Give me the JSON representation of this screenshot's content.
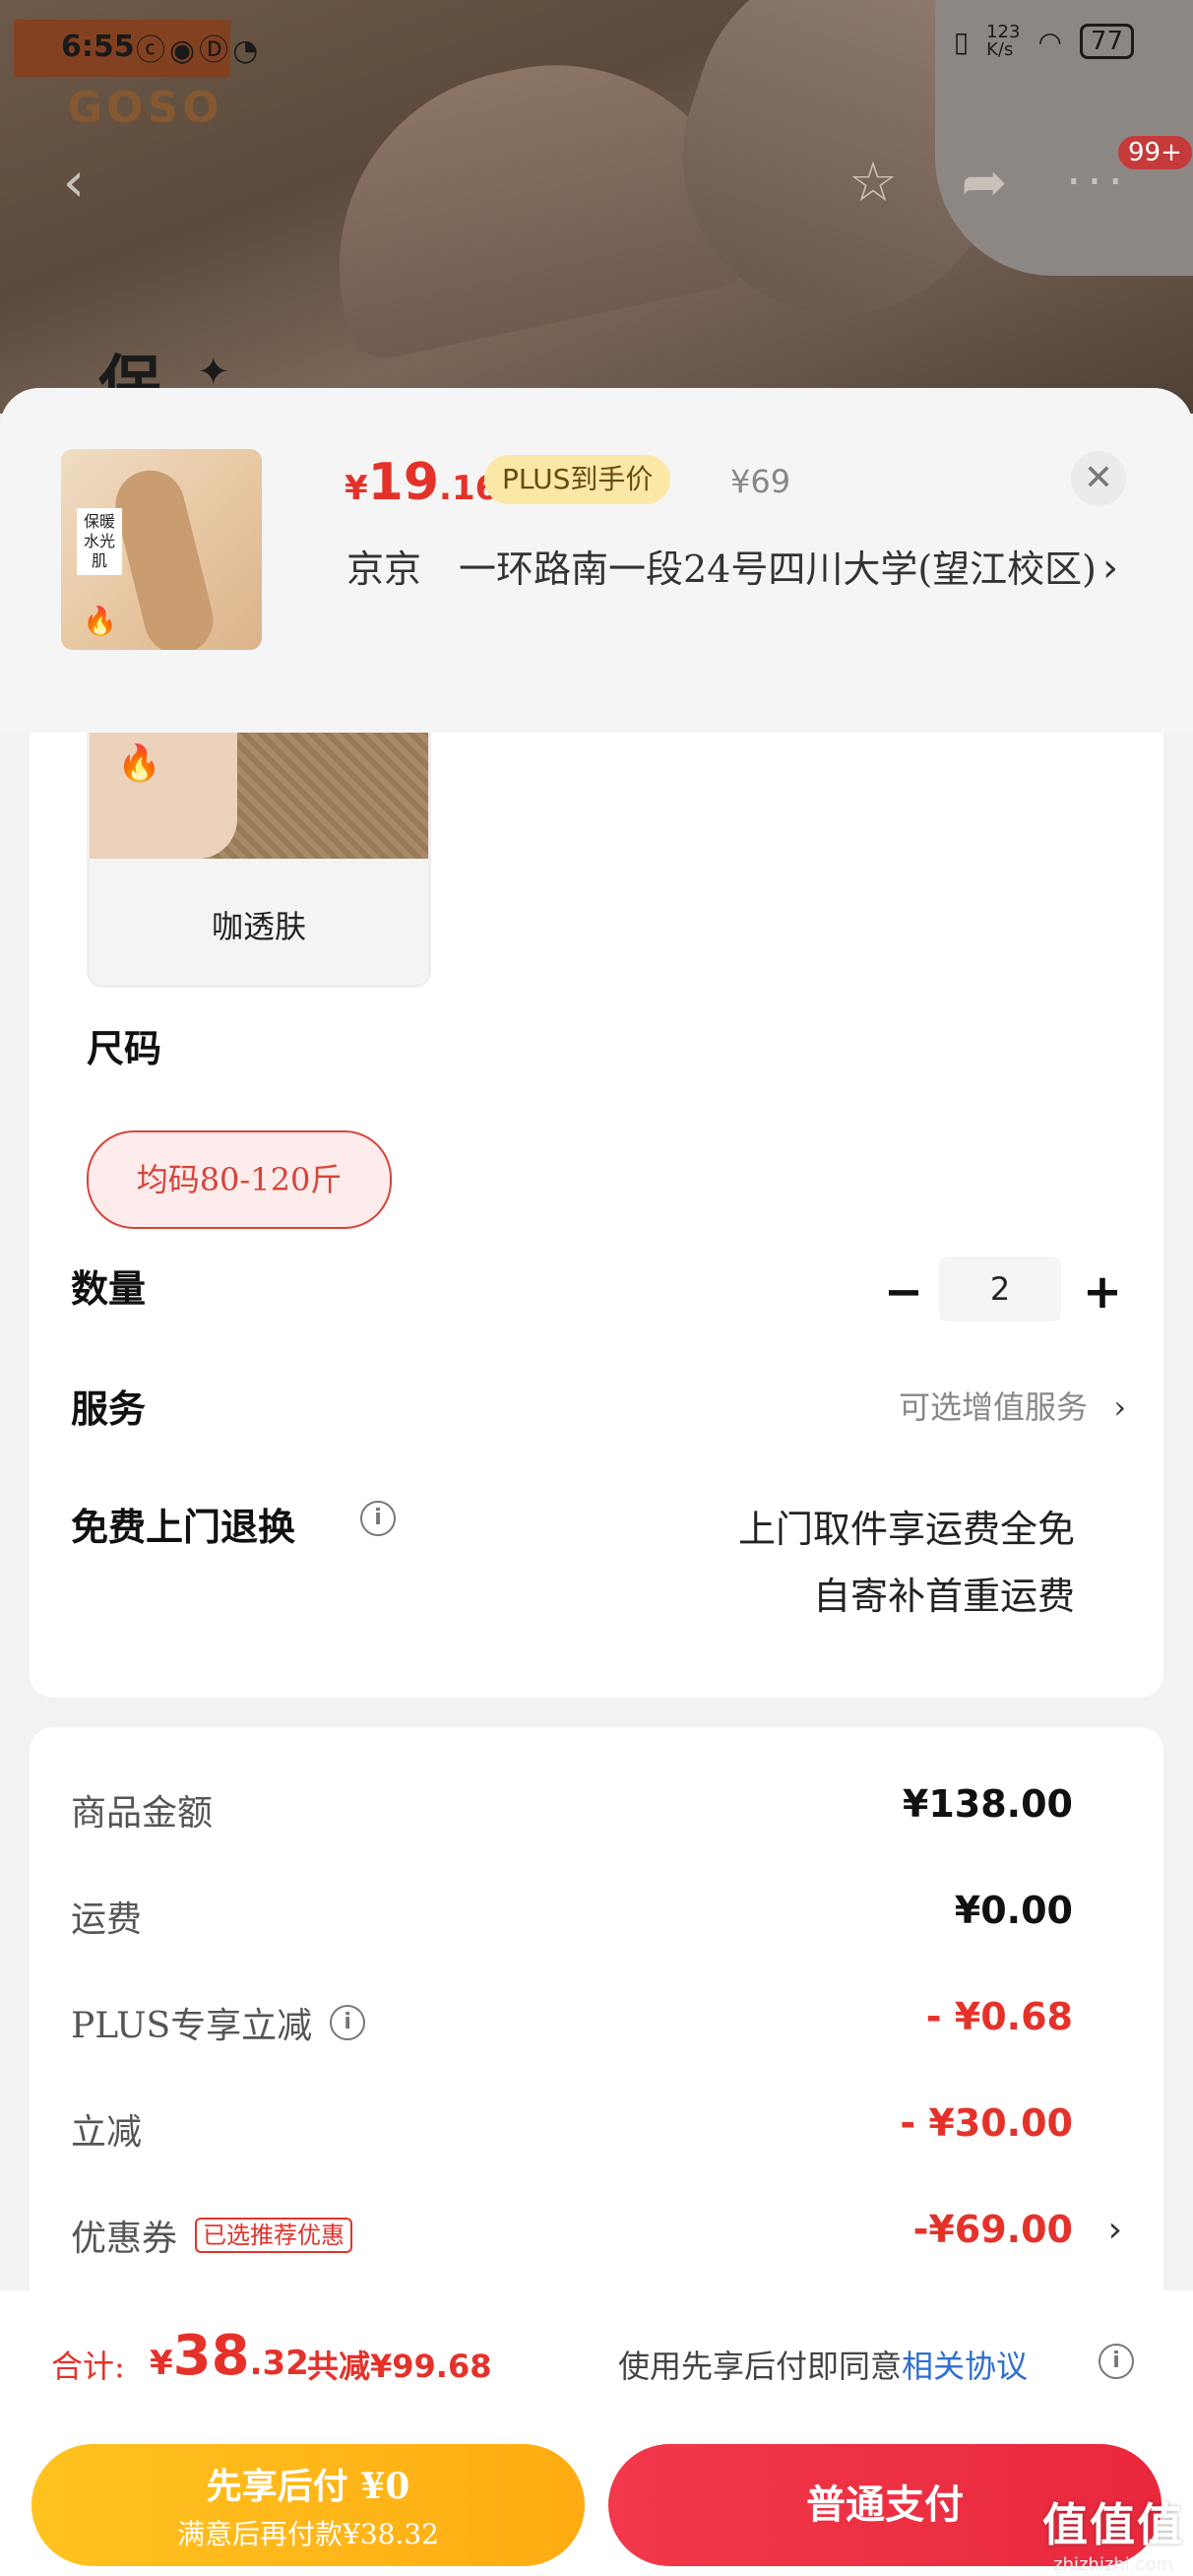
{
  "status_bar": {
    "time": "6:55",
    "left_icons": "ⓒ◉Ⓓ◔",
    "network_speed": "123\nK/s",
    "battery": "77"
  },
  "background": {
    "brand_text": "GOSO",
    "title_fragment": "保"
  },
  "nav": {
    "cart_badge": "99+"
  },
  "header": {
    "price_currency": "¥",
    "price_int": "19",
    "price_dec": ".16",
    "plus_label": "PLUS到手价",
    "original_price": "¥69",
    "address": "京京　一环路南一段24号四川大学(望江校区)"
  },
  "thumbnail": {
    "label": "保暖水光肌"
  },
  "color_option": {
    "label": "咖透肤"
  },
  "size": {
    "title": "尺码",
    "option": "均码80-120斤"
  },
  "quantity": {
    "title": "数量",
    "value": "2"
  },
  "service": {
    "title": "服务",
    "value": "可选增值服务"
  },
  "free_return": {
    "title": "免费上门退换",
    "line1": "上门取件享运费全免",
    "line2": "自寄补首重运费"
  },
  "breakdown": {
    "goods_label": "商品金额",
    "goods_value": "¥138.00",
    "shipping_label": "运费",
    "shipping_value": "¥0.00",
    "plus_discount_label": "PLUS专享立减",
    "plus_discount_value": "- ¥0.68",
    "instant_discount_label": "立减",
    "instant_discount_value": "- ¥30.00",
    "coupon_label": "优惠券",
    "coupon_tag": "已选推荐优惠",
    "coupon_value": "-¥69.00"
  },
  "footer": {
    "total_label": "合计:",
    "total_currency": "¥",
    "total_int": "38",
    "total_dec": ".32",
    "total_saved": "共减¥99.68",
    "agree_prefix": "使用先享后付即同意",
    "agree_link": "相关协议",
    "bnpl_line1": "先享后付 ¥0",
    "bnpl_line2": "满意后再付款¥38.32",
    "normal_pay": "普通支付"
  },
  "watermark": {
    "main": "值值值",
    "sub": "zhizhizhi.com"
  },
  "colors": {
    "accent_red": "#e4322a",
    "bnpl_yellow": "#ffb81a",
    "pay_red": "#ec2e42",
    "link_blue": "#2f6fd1"
  }
}
